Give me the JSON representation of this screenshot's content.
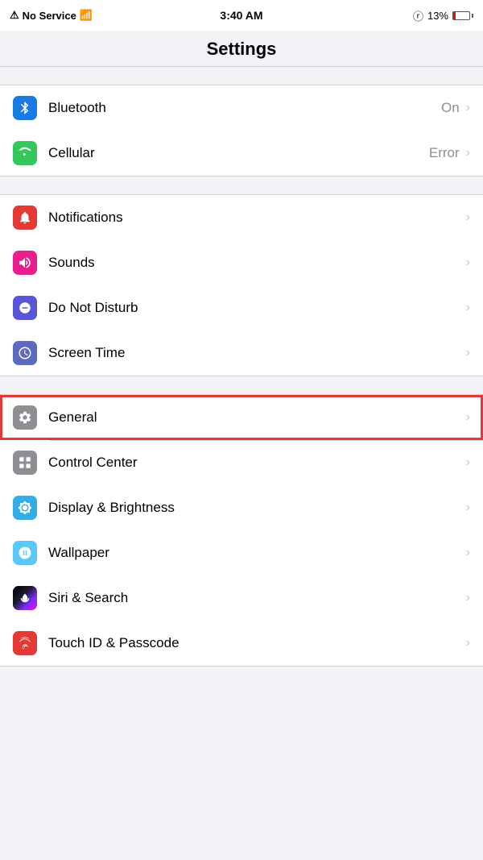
{
  "statusBar": {
    "carrier": "No Service",
    "time": "3:40 AM",
    "batteryPercent": "13%",
    "batteryLevel": 13
  },
  "pageTitle": "Settings",
  "groups": [
    {
      "id": "connectivity",
      "rows": [
        {
          "id": "bluetooth",
          "label": "Bluetooth",
          "value": "On",
          "iconColor": "icon-blue",
          "iconType": "bluetooth"
        },
        {
          "id": "cellular",
          "label": "Cellular",
          "value": "Error",
          "iconColor": "icon-green",
          "iconType": "cellular"
        }
      ]
    },
    {
      "id": "alerts",
      "rows": [
        {
          "id": "notifications",
          "label": "Notifications",
          "value": "",
          "iconColor": "icon-red",
          "iconType": "notifications"
        },
        {
          "id": "sounds",
          "label": "Sounds",
          "value": "",
          "iconColor": "icon-pink",
          "iconType": "sounds"
        },
        {
          "id": "donotdisturb",
          "label": "Do Not Disturb",
          "value": "",
          "iconColor": "icon-purple",
          "iconType": "donotdisturb"
        },
        {
          "id": "screentime",
          "label": "Screen Time",
          "value": "",
          "iconColor": "icon-indigo",
          "iconType": "screentime"
        }
      ]
    },
    {
      "id": "system",
      "rows": [
        {
          "id": "general",
          "label": "General",
          "value": "",
          "iconColor": "icon-gray",
          "iconType": "general",
          "highlighted": true
        },
        {
          "id": "controlcenter",
          "label": "Control Center",
          "value": "",
          "iconColor": "icon-gray",
          "iconType": "controlcenter"
        },
        {
          "id": "display",
          "label": "Display & Brightness",
          "value": "",
          "iconColor": "icon-teal",
          "iconType": "display"
        },
        {
          "id": "wallpaper",
          "label": "Wallpaper",
          "value": "",
          "iconColor": "icon-cyan",
          "iconType": "wallpaper"
        },
        {
          "id": "siri",
          "label": "Siri & Search",
          "value": "",
          "iconColor": "icon-siri",
          "iconType": "siri"
        },
        {
          "id": "touchid",
          "label": "Touch ID & Passcode",
          "value": "",
          "iconColor": "icon-touch",
          "iconType": "touchid"
        }
      ]
    }
  ]
}
